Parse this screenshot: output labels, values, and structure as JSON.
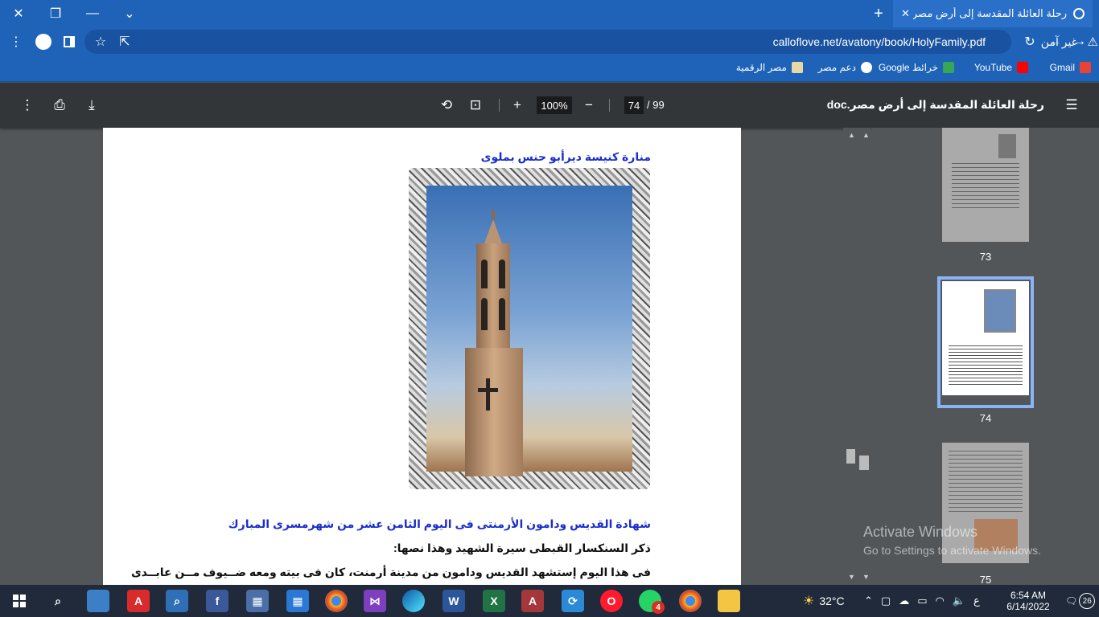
{
  "window": {
    "minimize": "—",
    "restore": "❐",
    "close": "✕",
    "tabsearch": "⌄"
  },
  "tab": {
    "title": "رحلة العائلة المقدسة إلى أرض مصر",
    "close": "✕",
    "new": "+"
  },
  "omnibox": {
    "security": "غير آمن",
    "url": "calloflove.net/avatony/book/HolyFamily.pdf"
  },
  "bookmarks": [
    {
      "label": "Gmail",
      "color": "#ea4335"
    },
    {
      "label": "YouTube",
      "color": "#ff0000"
    },
    {
      "label": "خرائط Google",
      "color": "#34a853"
    },
    {
      "label": "دعم مصر",
      "color": "#ffffff"
    },
    {
      "label": "مصر الرقمية",
      "color": "#e9d8a6"
    }
  ],
  "pdf": {
    "title": "رحلة العائلة المقدسة إلى أرض مصر.doc",
    "page": "74",
    "total": "/ 99",
    "zoom": "100%"
  },
  "content": {
    "caption": "منارة كنيسة ديرأبو حنس بملوى",
    "heading": "شهادة القديس ودامون الأرمنتى فى اليوم الثامن عشر من شهرمسرى المبارك",
    "line1": "ذكر السنكسار القبطى سيرة الشهيد وهذا نصها:",
    "line2": "فى هذا اليوم إستشهد القديس ودامون من مدينة أرمنت، كان فى بيته ومعه ضــيوف مــن عابــدى"
  },
  "thumbnails": [
    {
      "label": "73"
    },
    {
      "label": "74"
    },
    {
      "label": "75"
    }
  ],
  "watermark": {
    "title": "Activate Windows",
    "sub": "Go to Settings to activate Windows."
  },
  "taskbar": {
    "temp": "32°C",
    "time": "6:54 AM",
    "date": "6/14/2022",
    "lang": "ع",
    "notif": "26",
    "badge": "4"
  }
}
